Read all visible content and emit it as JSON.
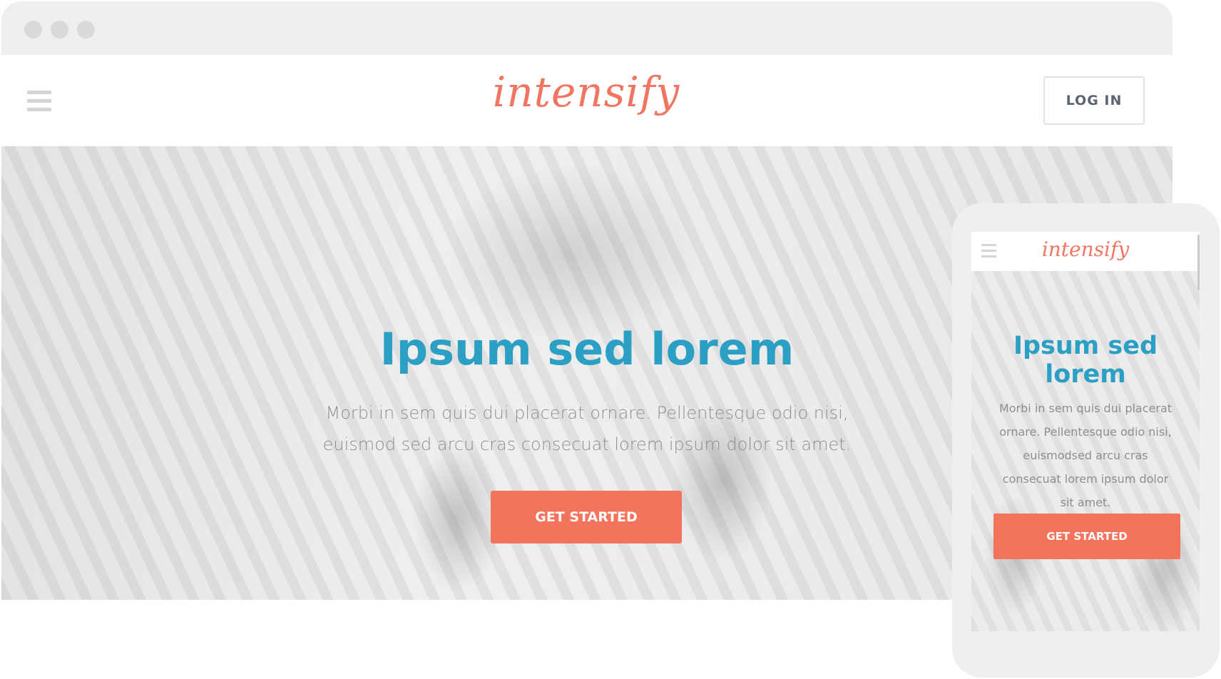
{
  "brand": {
    "name": "intensify",
    "accent": "#f27561",
    "heading": "#2c9fc5"
  },
  "desktop": {
    "header": {
      "menu_icon": "hamburger-icon",
      "login_label": "LOG IN"
    },
    "hero": {
      "title": "Ipsum sed lorem",
      "text": "Morbi in sem quis dui placerat ornare. Pellentesque odio nisi, euismod sed arcu cras consecuat lorem ipsum dolor sit amet.",
      "cta_label": "GET STARTED"
    }
  },
  "mobile": {
    "header": {
      "menu_icon": "hamburger-icon"
    },
    "hero": {
      "title": "Ipsum sed lorem",
      "text": "Morbi in sem quis dui placerat ornare. Pellentesque odio nisi, euismodsed arcu cras consecuat lorem ipsum dolor sit amet.",
      "cta_label": "GET STARTED"
    }
  }
}
